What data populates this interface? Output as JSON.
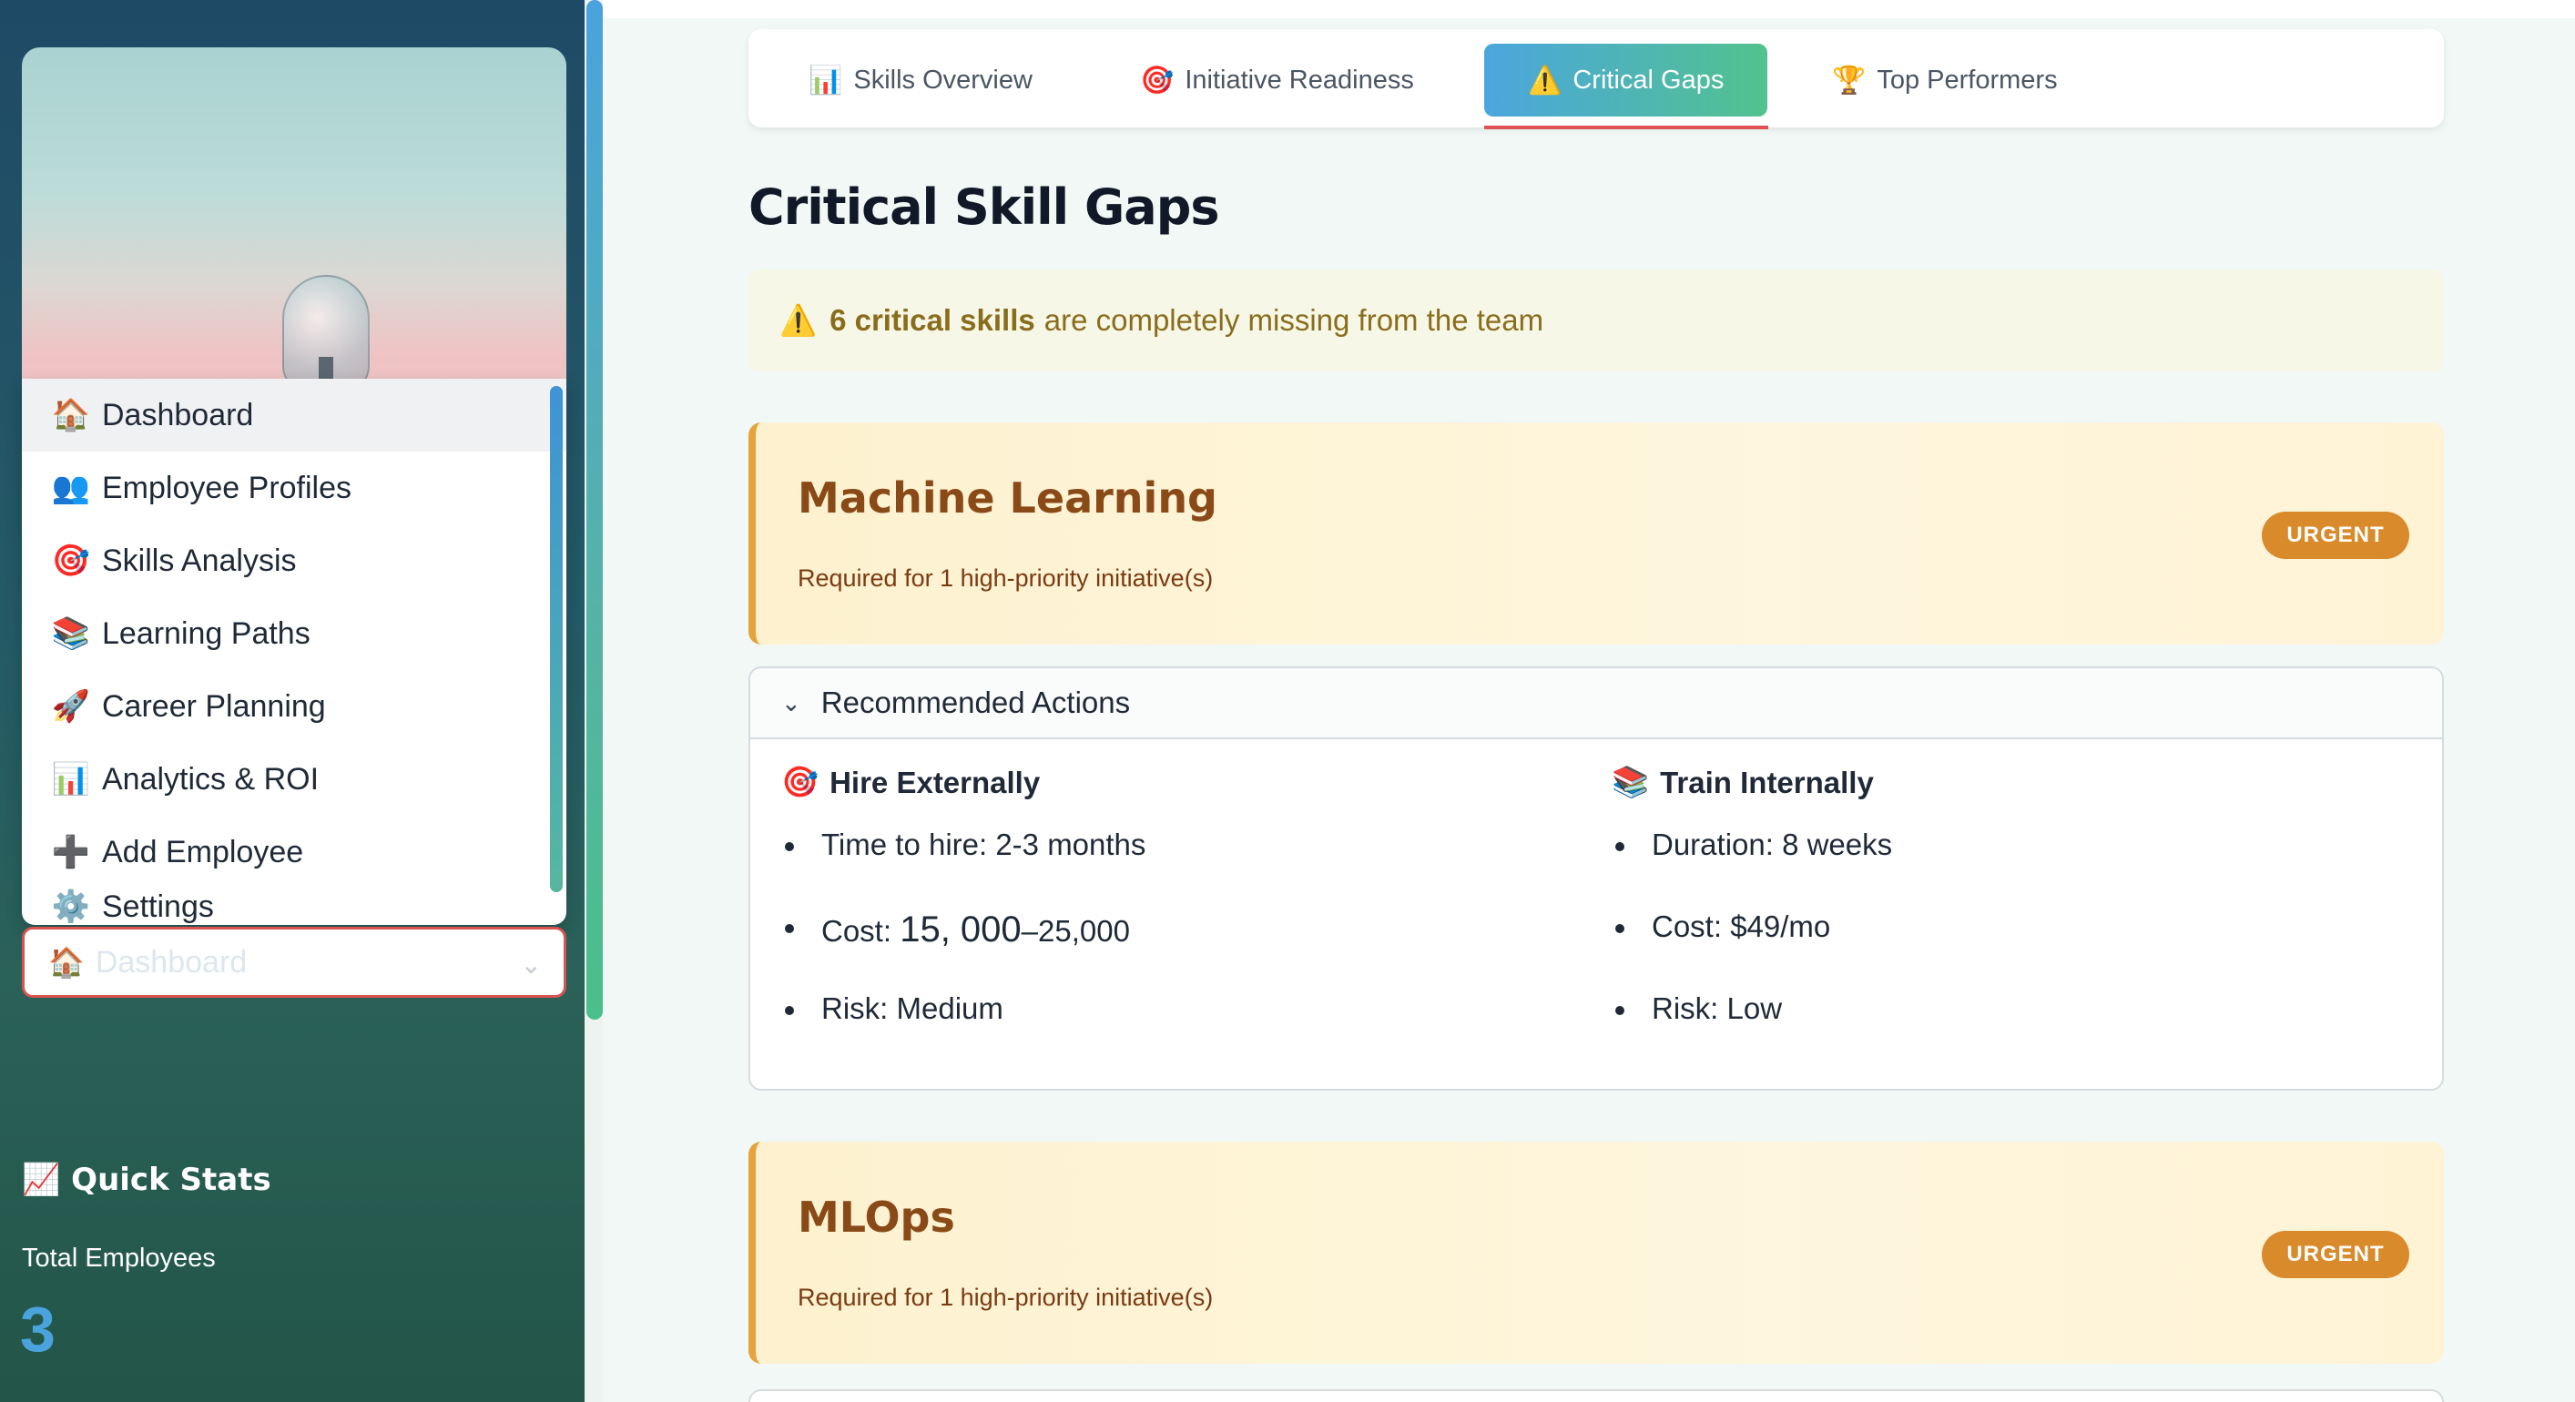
{
  "sidebar": {
    "menu": [
      {
        "icon": "🏠",
        "label": "Dashboard"
      },
      {
        "icon": "👥",
        "label": "Employee Profiles"
      },
      {
        "icon": "🎯",
        "label": "Skills Analysis"
      },
      {
        "icon": "📚",
        "label": "Learning Paths"
      },
      {
        "icon": "🚀",
        "label": "Career Planning"
      },
      {
        "icon": "📊",
        "label": "Analytics & ROI"
      },
      {
        "icon": "➕",
        "label": "Add Employee"
      },
      {
        "icon": "⚙️",
        "label": "Settings"
      }
    ],
    "select": {
      "icon": "🏠",
      "value": "Dashboard"
    },
    "quick_stats": {
      "title": "📈 Quick Stats",
      "total_employees_label": "Total Employees",
      "total_employees_value": "3"
    }
  },
  "tabs": [
    {
      "icon": "📊",
      "label": "Skills Overview"
    },
    {
      "icon": "🎯",
      "label": "Initiative Readiness"
    },
    {
      "icon": "⚠️",
      "label": "Critical Gaps"
    },
    {
      "icon": "🏆",
      "label": "Top Performers"
    }
  ],
  "active_tab": "Critical Gaps",
  "page": {
    "title": "Critical Skill Gaps",
    "alert": {
      "icon": "⚠️",
      "bold": "6 critical skills",
      "text": "are completely missing from the team"
    }
  },
  "gaps": [
    {
      "name": "Machine Learning",
      "desc": "Required for 1 high-priority initiative(s)",
      "badge": "URGENT"
    },
    {
      "name": "MLOps",
      "desc": "Required for 1 high-priority initiative(s)",
      "badge": "URGENT"
    }
  ],
  "actions": {
    "header": "Recommended Actions",
    "hire": {
      "icon": "🎯",
      "title": "Hire Externally",
      "time": "Time to hire: 2-3 months",
      "cost_prefix": "Cost: ",
      "cost_mid": "15, 000",
      "cost_suffix": "–25,000",
      "risk": "Risk: Medium"
    },
    "train": {
      "icon": "📚",
      "title": "Train Internally",
      "duration": "Duration: 8 weeks",
      "cost": "Cost: $49/mo",
      "risk": "Risk: Low"
    }
  },
  "colors": {
    "accent_blue": "#4ba6de",
    "accent_green": "#52c28e",
    "urgent": "#d98a2a",
    "danger": "#e05252"
  }
}
